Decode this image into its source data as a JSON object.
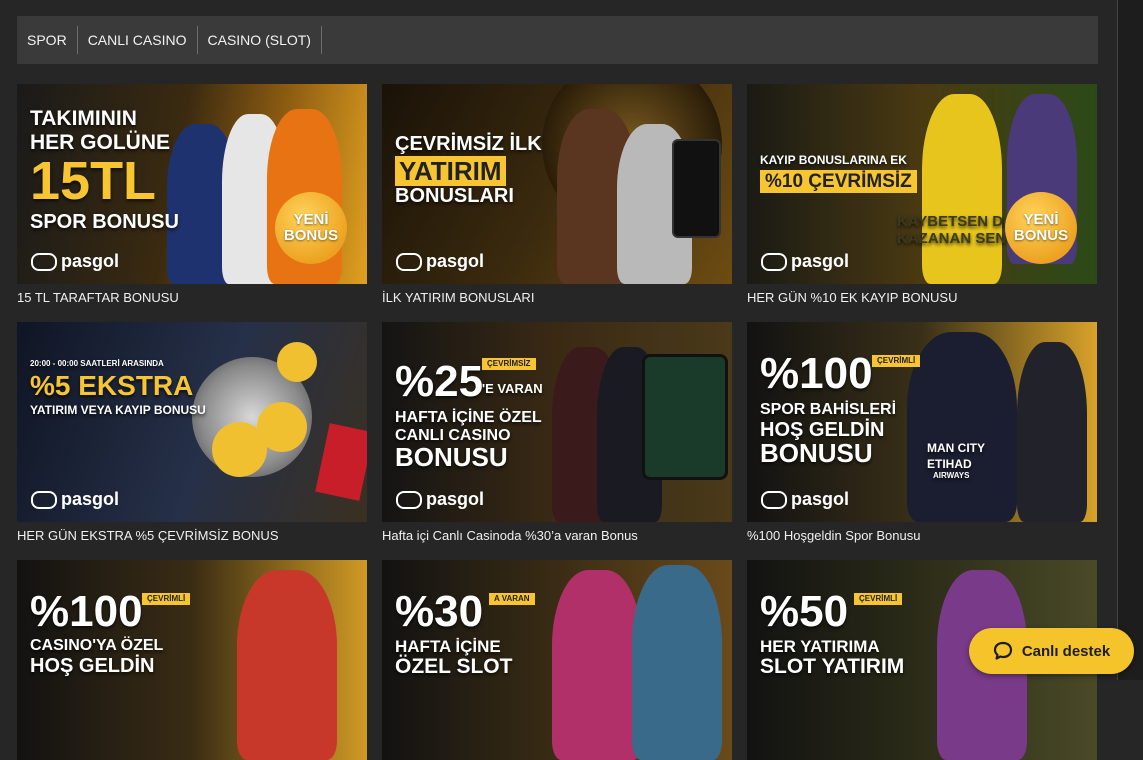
{
  "tabs": [
    "SPOR",
    "CANLI CASINO",
    "CASINO (SLOT)"
  ],
  "cards": [
    {
      "caption": "15 TL TARAFTAR BONUSU",
      "lines": [
        "TAKIMININ",
        "HER GOLÜNE",
        "15TL",
        "SPOR BONUSU"
      ],
      "badge": [
        "YENİ",
        "BONUS"
      ],
      "logo": "pasgol"
    },
    {
      "caption": "İLK YATIRIM BONUSLARI",
      "lines": [
        "ÇEVRİMSİZ İLK",
        "YATIRIM",
        "BONUSLARI"
      ],
      "logo": "pasgol"
    },
    {
      "caption": "HER GÜN %10 EK KAYIP BONUSU",
      "lines": [
        "KAYIP BONUSLARINA EK",
        "%10 ÇEVRİMSİZ",
        "KAYBETSEN DE",
        "KAZANAN SEN"
      ],
      "badge": [
        "YENİ",
        "BONUS"
      ],
      "logo": "pasgol"
    },
    {
      "caption": "HER GÜN EKSTRA %5 ÇEVRİMSİZ BONUS",
      "lines": [
        "20:00 - 00:00 SAATLERİ ARASINDA",
        "%5 EKSTRA",
        "YATIRIM VEYA KAYIP BONUSU"
      ],
      "logo": "pasgol"
    },
    {
      "caption": "Hafta içi Canlı Casinoda %30’a varan Bonus",
      "lines": [
        "%25",
        "'E VARAN",
        "ÇEVRİMSİZ",
        "HAFTA İÇİNE ÖZEL",
        "CANLI CASINO",
        "BONUSU"
      ],
      "logo": "pasgol"
    },
    {
      "caption": "%100 Hoşgeldin Spor Bonusu",
      "lines": [
        "%100",
        "ÇEVRİMLİ",
        "SPOR BAHİSLERİ",
        "HOŞ GELDİN",
        "BONUSU",
        "MAN CITY",
        "ETIHAD",
        "AIRWAYS"
      ],
      "logo": "pasgol"
    },
    {
      "caption": "",
      "lines": [
        "%100",
        "ÇEVRİMLİ",
        "CASINO'YA ÖZEL",
        "HOŞ GELDİN"
      ]
    },
    {
      "caption": "",
      "lines": [
        "%30",
        "A VARAN",
        "HAFTA İÇİNE",
        "ÖZEL SLOT"
      ]
    },
    {
      "caption": "",
      "lines": [
        "%50",
        "ÇEVRİMLİ",
        "HER YATIRIMA",
        "SLOT YATIRIM"
      ]
    }
  ],
  "support": {
    "label": "Canlı destek",
    "icon": "chat-bubble-icon"
  },
  "colors": {
    "accent": "#f5c42a",
    "background": "#262626",
    "tabbar": "#3a3a3a"
  }
}
